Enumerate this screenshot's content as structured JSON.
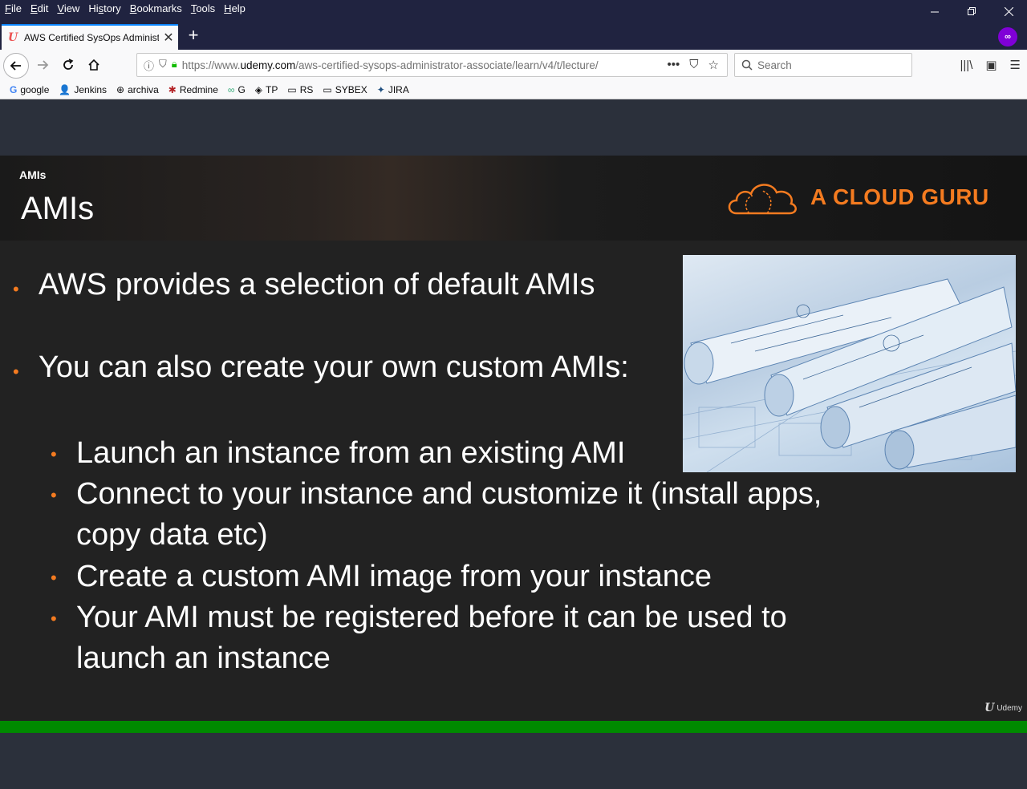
{
  "menubar": {
    "items": [
      {
        "u": "F",
        "rest": "ile"
      },
      {
        "u": "E",
        "rest": "dit"
      },
      {
        "u": "V",
        "rest": "iew"
      },
      {
        "pre": "Hi",
        "u": "s",
        "rest": "tory"
      },
      {
        "u": "B",
        "rest": "ookmarks"
      },
      {
        "u": "T",
        "rest": "ools"
      },
      {
        "u": "H",
        "rest": "elp"
      }
    ]
  },
  "tab": {
    "title": "AWS Certified SysOps Administ",
    "favicon": "U"
  },
  "urlbar": {
    "url_prefix": "https://www.",
    "url_domain": "udemy.com",
    "url_path": "/aws-certified-sysops-administrator-associate/learn/v4/t/lecture/"
  },
  "search": {
    "placeholder": "Search"
  },
  "bookmarks": [
    {
      "icon": "G",
      "label": "google"
    },
    {
      "icon": "👤",
      "label": "Jenkins"
    },
    {
      "icon": "⊕",
      "label": "archiva"
    },
    {
      "icon": "✱",
      "label": "Redmine"
    },
    {
      "icon": "∞",
      "label": "G"
    },
    {
      "icon": "◈",
      "label": "TP"
    },
    {
      "icon": "▭",
      "label": "RS"
    },
    {
      "icon": "▭",
      "label": "SYBEX"
    },
    {
      "icon": "✦",
      "label": "JIRA"
    }
  ],
  "slide": {
    "crumb": "AMIs",
    "title": "AMIs",
    "logo_text": "A CLOUD GURU",
    "bullet1": "AWS provides a selection of default AMIs",
    "bullet2": "You can also create your own custom AMIs:",
    "sub1": "Launch an instance from an existing AMI",
    "sub2a": "Connect to your instance and customize it (install apps,",
    "sub2b": "copy data etc)",
    "sub3": "Create a custom AMI image from your instance",
    "sub4a": "Your AMI must be registered before it can be used to",
    "sub4b": "launch an instance",
    "watermark": "Udemy"
  },
  "video": {
    "progress_fraction": 1.0
  },
  "colors": {
    "accent_orange": "#f47b20",
    "progress_green": "#008a00",
    "chrome_dark": "#202340"
  }
}
